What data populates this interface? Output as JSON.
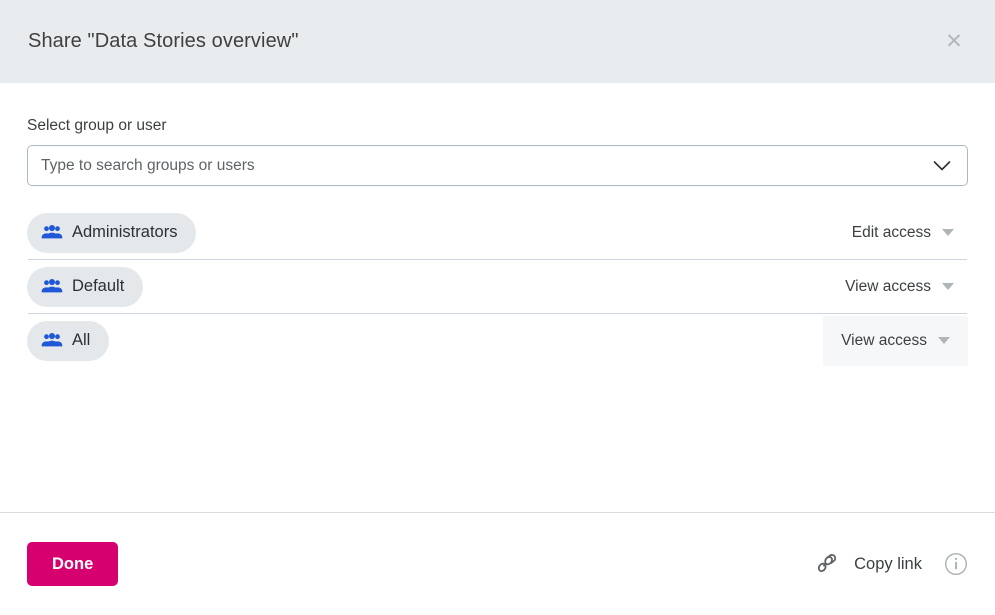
{
  "dialog": {
    "title": "Share \"Data Stories overview\"",
    "close_icon": "close-icon"
  },
  "search": {
    "label": "Select group or user",
    "value": "",
    "placeholder": "Type to search groups or users",
    "chevron_icon": "chevron-down-icon"
  },
  "access_rows": [
    {
      "name": "Administrators",
      "icon": "group-icon",
      "access": "Edit access",
      "caret_icon": "caret-down-icon",
      "highlighted": false
    },
    {
      "name": "Default",
      "icon": "group-icon",
      "access": "View access",
      "caret_icon": "caret-down-icon",
      "highlighted": false
    },
    {
      "name": "All",
      "icon": "group-icon",
      "access": "View access",
      "caret_icon": "caret-down-icon",
      "highlighted": true
    }
  ],
  "footer": {
    "done_label": "Done",
    "copy_link_label": "Copy link",
    "link_icon": "link-icon",
    "info_icon": "info-circle-icon"
  },
  "colors": {
    "header_bg": "#e8ecee",
    "chip_bg": "#e4e8eb",
    "group_icon": "#1f57d6",
    "primary_button": "#d6006e",
    "divider": "#ccd4de",
    "text": "#3c4043",
    "muted_icon": "#b0b5b9"
  }
}
